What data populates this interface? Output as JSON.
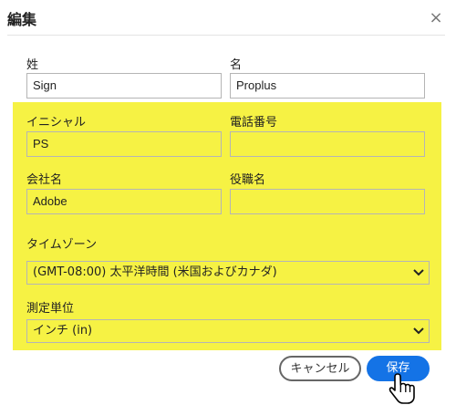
{
  "dialog": {
    "title": "編集",
    "close_symbol": "×"
  },
  "fields": {
    "last_name": {
      "label": "姓",
      "value": "Sign"
    },
    "first_name": {
      "label": "名",
      "value": "Proplus"
    },
    "initials": {
      "label": "イニシャル",
      "value": "PS"
    },
    "phone": {
      "label": "電話番号",
      "value": ""
    },
    "company": {
      "label": "会社名",
      "value": "Adobe"
    },
    "job_title": {
      "label": "役職名",
      "value": ""
    },
    "timezone": {
      "label": "タイムゾーン",
      "value": "(GMT-08:00) 太平洋時間 (米国およびカナダ)"
    },
    "units": {
      "label": "測定単位",
      "value": "インチ (in)"
    }
  },
  "buttons": {
    "cancel": "キャンセル",
    "save": "保存"
  },
  "colors": {
    "highlight": "#f6f244",
    "primary": "#1473e6"
  },
  "icons": {
    "close": "close-icon",
    "dropdown": "chevron-down-icon",
    "cursor": "hand-pointer-icon"
  }
}
